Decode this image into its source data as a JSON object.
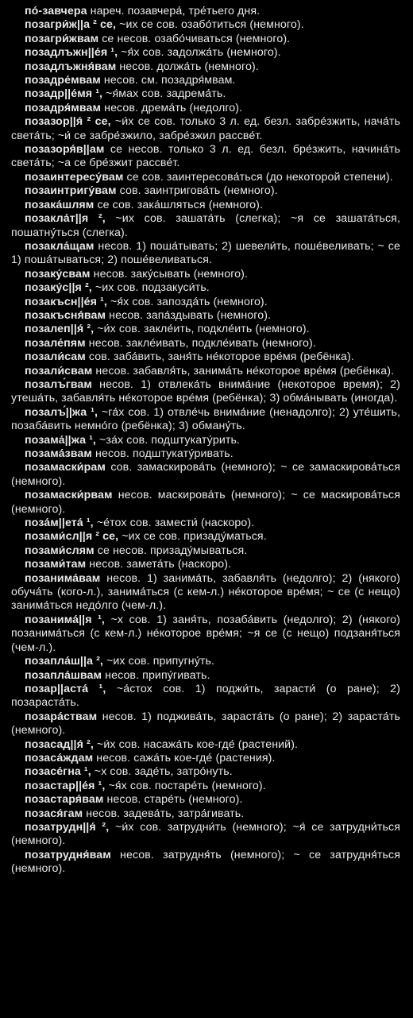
{
  "entries": [
    {
      "hw": "по́-завчера",
      "body": " нареч. позавчера́, тре́тьего дня."
    },
    {
      "hw": "позагри́ж||а ² се,",
      "body": " ~их се сов. озабо́титься (немного)."
    },
    {
      "hw": "позагри́жвам",
      "body": " се несов. озабо́чиваться (немного)."
    },
    {
      "hw": "позадлъжн||е́я ¹,",
      "body": " ~я́х сов. задолжа́ть (немного)."
    },
    {
      "hw": "позадлъжня́вам",
      "body": " несов. должа́ть (немного)."
    },
    {
      "hw": "позадре́мвам",
      "body": " несов. см. позадря́мвам."
    },
    {
      "hw": "позадр||е́мя ¹,",
      "body": " ~я́мах сов. задрема́ть."
    },
    {
      "hw": "позадря́мвам",
      "body": " несов. дрема́ть (недолго)."
    },
    {
      "hw": "позазор||я́ ² се,",
      "body": " ~и́х се сов. только 3 л. ед. безл. забре́зжить, нача́ть света́ть; ~и́ се забре́зжило, забре́зжил рассве́т."
    },
    {
      "hw": "позазоря́в||ам",
      "body": " се несов. только 3 л. ед. безл. бре́зжить, начина́ть света́ть; ~а се бре́зжит рассве́т."
    },
    {
      "hw": "позаинтересу́вам",
      "body": " се сов. заинтересова́ться (до некоторой степени)."
    },
    {
      "hw": "позаинтригу́вам",
      "body": " сов. заинтригова́ть (немного)."
    },
    {
      "hw": "позака́шлям",
      "body": " се сов. зака́шляться (немного)."
    },
    {
      "hw": "позакла́т||я ²,",
      "body": " ~их сов. зашата́ть (слегка); ~я се зашата́ться, пошатну́ться (слегка)."
    },
    {
      "hw": "позакла́щам",
      "body": " несов. 1) поша́тывать; 2) шевели́ть, поше́веливать; ~ се 1) поша́тываться; 2) поше́веливаться."
    },
    {
      "hw": "позаку́свам",
      "body": " несов. заку́сывать (немного)."
    },
    {
      "hw": "позаку́с||я ²,",
      "body": " ~их сов. подзакуси́ть."
    },
    {
      "hw": "позакъсн||е́я ¹,",
      "body": " ~я́х сов. запозда́ть (немного)."
    },
    {
      "hw": "позакъсня́вам",
      "body": " несов. запа́здывать (немного)."
    },
    {
      "hw": "позалеп||я́ ²,",
      "body": " ~и́х сов. закле́ить, подкле́ить (немного)."
    },
    {
      "hw": "позале́пям",
      "body": " несов. закле́ивать, подкле́ивать (немного)."
    },
    {
      "hw": "позали́сам",
      "body": " сов. заба́вить, заня́ть не́которое вре́мя (ребёнка)."
    },
    {
      "hw": "позали́свам",
      "body": " несов. забавля́ть, занима́ть не́которое вре́мя (ребёнка)."
    },
    {
      "hw": "позалъ́гвам",
      "body": " несов. 1) отвлека́ть внима́ние (некоторое время); 2) утеша́ть, забавля́ть не́которое вре́мя (ребёнка); 3) обма́нывать (иногда)."
    },
    {
      "hw": "позалъ́||жа ¹,",
      "body": " ~га́х сов. 1) отвле́чь внима́ние (ненадолго); 2) уте́шить, позаба́вить немно́го (ребёнка); 3) обману́ть."
    },
    {
      "hw": "позама́||жа ¹,",
      "body": " ~за́х сов. подштукату́рить."
    },
    {
      "hw": "позама́звам",
      "body": " несов. подштукату́ривать."
    },
    {
      "hw": "позамаски́рам",
      "body": " сов. замаскирова́ть (немного); ~ се замаскирова́ться (немного)."
    },
    {
      "hw": "позамаски́рвам",
      "body": " несов. маскирова́ть (немного); ~ се маскирова́ться (немного)."
    },
    {
      "hw": "поза́м||ета́ ¹,",
      "body": " ~е́тох сов. замести́ (наскоро)."
    },
    {
      "hw": "позами́сл||я ² се,",
      "body": " ~их се сов. призаду́маться."
    },
    {
      "hw": "позами́слям",
      "body": " се несов. призаду́мываться."
    },
    {
      "hw": "позами́там",
      "body": " несов. замета́ть (наскоро)."
    },
    {
      "hw": "позанима́вам",
      "body": " несов. 1) занима́ть, забавля́ть (недолго); 2) (някого) обуча́ть (кого-л.), занима́ться (с кем-л.) не́которое вре́мя; ~ се (с нещо) занима́ться недо́лго (чем-л.)."
    },
    {
      "hw": "позанима́||я ¹,",
      "body": " ~х сов. 1) заня́ть, позаба́вить (недолго); 2) (някого) позанима́ться (с кем-л.) не́которое вре́мя; ~я се (с нещо) подзаня́ться (чем-л.)."
    },
    {
      "hw": "позапла́ш||а ²,",
      "body": " ~их сов. припугну́ть."
    },
    {
      "hw": "позапла́швам",
      "body": " несов. припу́гивать."
    },
    {
      "hw": "позар||аста́ ¹,",
      "body": " ~а́стох сов. 1) поджи́ть, зарасти́ (о ране); 2) позараста́ть."
    },
    {
      "hw": "позара́ствам",
      "body": " несов. 1) поджива́ть, зараста́ть (о ране); 2) зараста́ть (немного)."
    },
    {
      "hw": "позасад||я́ ²,",
      "body": " ~и́х сов. насажа́ть кое-где́ (растений)."
    },
    {
      "hw": "позаса́ждам",
      "body": " несов. сажа́ть кое-где́ (растения)."
    },
    {
      "hw": "позасе́гна ¹,",
      "body": " ~х сов. заде́ть, затро́нуть."
    },
    {
      "hw": "позастар||е́я ¹,",
      "body": " ~я́х сов. постаре́ть (немного)."
    },
    {
      "hw": "позастаря́вам",
      "body": " несов. старе́ть (немного)."
    },
    {
      "hw": "позася́гам",
      "body": " несов. задева́ть, затра́гивать."
    },
    {
      "hw": "позатрудн||я́ ²,",
      "body": " ~и́х сов. затрудни́ть (немного); ~я́ се затрудни́ться (немного)."
    },
    {
      "hw": "позатрудня́вам",
      "body": " несов. затрудня́ть (немного); ~ се затрудня́ться (немного)."
    }
  ]
}
